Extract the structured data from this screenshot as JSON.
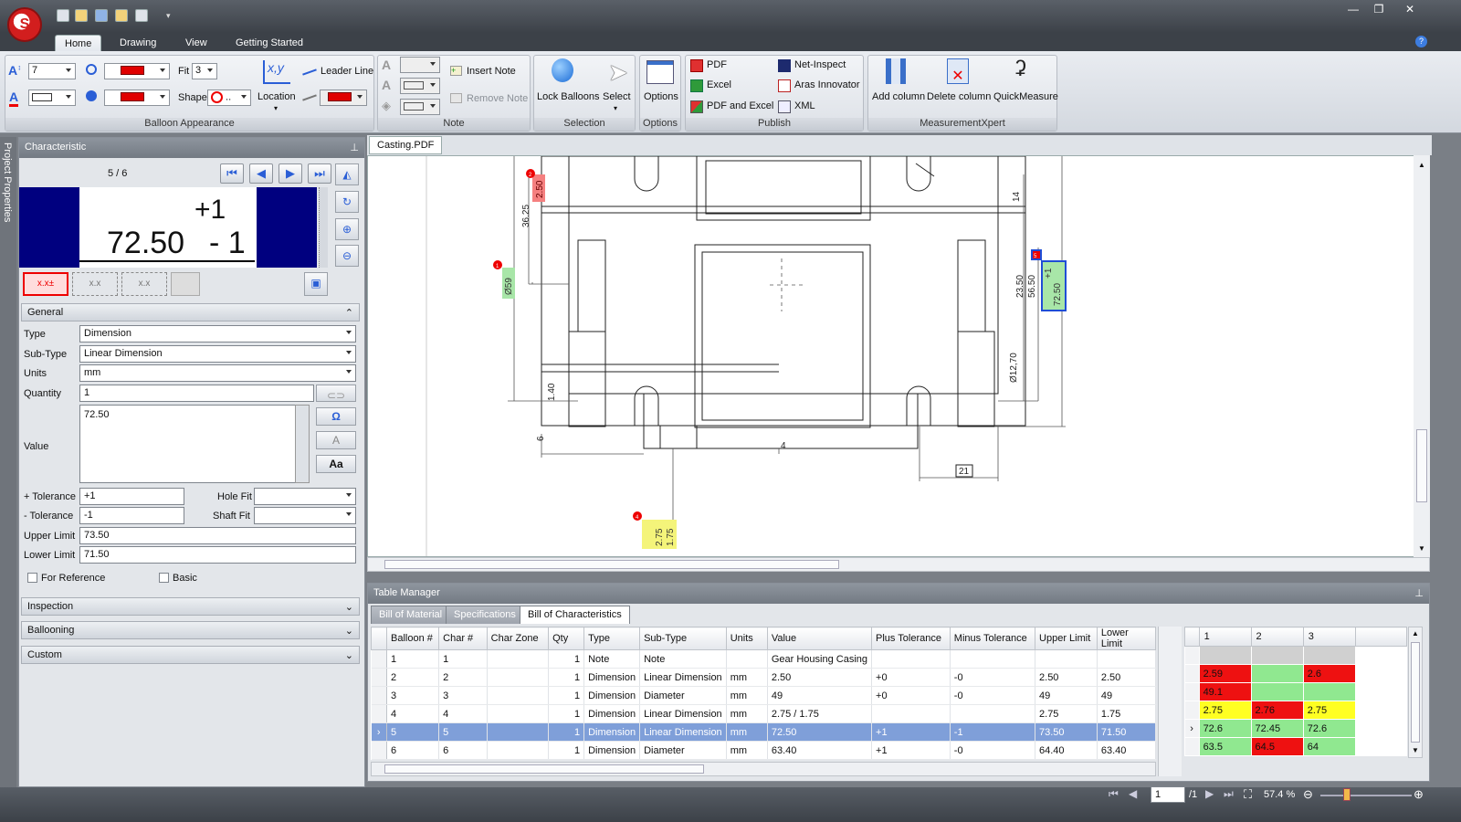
{
  "app": {
    "logo_text": "S"
  },
  "ribbon_tabs": [
    "Home",
    "Drawing",
    "View",
    "Getting Started"
  ],
  "ribbon": {
    "balloon_appearance": {
      "label": "Balloon Appearance",
      "font_size": "7",
      "fit_label": "Fit",
      "fit_value": "3",
      "shape_label": "Shape",
      "location_label": "Location",
      "leader_line_label": "Leader Line"
    },
    "note": {
      "label": "Note",
      "insert_note": "Insert Note",
      "remove_note": "Remove Note"
    },
    "selection": {
      "label": "Selection",
      "lock_balloons": "Lock Balloons",
      "select": "Select"
    },
    "options": {
      "label": "Options",
      "options_btn": "Options"
    },
    "publish": {
      "label": "Publish",
      "pdf": "PDF",
      "excel": "Excel",
      "pdf_excel": "PDF and Excel",
      "net_inspect": "Net-Inspect",
      "aras": "Aras Innovator",
      "xml": "XML"
    },
    "measurementxpert": {
      "label": "MeasurementXpert",
      "add_column": "Add column",
      "delete_column": "Delete column",
      "quick_measure": "QuickMeasure"
    }
  },
  "left_strip_label": "Project Properties",
  "characteristic": {
    "title": "Characteristic",
    "counter": "5 / 6",
    "preview_plus": "+1",
    "preview_value": "72.50",
    "preview_minus": "- 1",
    "sections": {
      "general": "General",
      "inspection": "Inspection",
      "ballooning": "Ballooning",
      "custom": "Custom"
    },
    "fields": {
      "type_label": "Type",
      "type_value": "Dimension",
      "subtype_label": "Sub-Type",
      "subtype_value": "Linear Dimension",
      "units_label": "Units",
      "units_value": "mm",
      "quantity_label": "Quantity",
      "quantity_value": "1",
      "value_label": "Value",
      "value_value": "72.50",
      "plus_tol_label": "+ Tolerance",
      "plus_tol_value": "+1",
      "minus_tol_label": "- Tolerance",
      "minus_tol_value": "-1",
      "hole_fit_label": "Hole Fit",
      "shaft_fit_label": "Shaft Fit",
      "upper_label": "Upper Limit",
      "upper_value": "73.50",
      "lower_label": "Lower Limit",
      "lower_value": "71.50",
      "for_reference": "For Reference",
      "basic": "Basic"
    }
  },
  "document": {
    "tab": "Casting.PDF"
  },
  "drawing_labels": {
    "dim_36_25": "36.25",
    "dim_2_50": "2.50",
    "dim_59": "Ø59",
    "dim_14": "14",
    "dim_23_50": "23.50",
    "dim_56_50": "56.50",
    "dim_12_70": "Ø12,70",
    "dim_1_40": "1.40",
    "dim_6": "6",
    "dim_4": "4",
    "dim_21": "21",
    "callout_top": "2.75",
    "callout_bottom": "1.75",
    "sel_plus": "+1",
    "sel_value": "72.50",
    "sel_minus": "-1",
    "b1": "1",
    "b2": "2",
    "b4": "4",
    "b5": "5"
  },
  "table_manager": {
    "title": "Table Manager",
    "tabs": [
      "Bill of Material",
      "Specifications",
      "Bill of Characteristics"
    ],
    "columns": [
      "Balloon #",
      "Char #",
      "Char Zone",
      "Qty",
      "Type",
      "Sub-Type",
      "Units",
      "Value",
      "Plus Tolerance",
      "Minus Tolerance",
      "Upper Limit",
      "Lower Limit"
    ],
    "rows": [
      [
        "1",
        "1",
        "",
        "1",
        "Note",
        "Note",
        "",
        "Gear Housing Casing",
        "",
        "",
        "",
        ""
      ],
      [
        "2",
        "2",
        "",
        "1",
        "Dimension",
        "Linear Dimension",
        "mm",
        "2.50",
        "+0",
        "-0",
        "2.50",
        "2.50"
      ],
      [
        "3",
        "3",
        "",
        "1",
        "Dimension",
        "Diameter",
        "mm",
        "49",
        "+0",
        "-0",
        "49",
        "49"
      ],
      [
        "4",
        "4",
        "",
        "1",
        "Dimension",
        "Linear Dimension",
        "mm",
        "2.75 / 1.75",
        "",
        "",
        "2.75",
        "1.75"
      ],
      [
        "5",
        "5",
        "",
        "1",
        "Dimension",
        "Linear Dimension",
        "mm",
        "72.50",
        "+1",
        "-1",
        "73.50",
        "71.50"
      ],
      [
        "6",
        "6",
        "",
        "1",
        "Dimension",
        "Diameter",
        "mm",
        "63.40",
        "+1",
        "-0",
        "64.40",
        "63.40"
      ]
    ],
    "inspection_columns": [
      "1",
      "2",
      "3"
    ],
    "inspection_rows": [
      [
        {
          "v": "",
          "c": "#d0d0d0"
        },
        {
          "v": "",
          "c": "#d0d0d0"
        },
        {
          "v": "",
          "c": "#d0d0d0"
        }
      ],
      [
        {
          "v": "2.59",
          "c": "#ee1111"
        },
        {
          "v": "",
          "c": "#90e890"
        },
        {
          "v": "2.6",
          "c": "#ee1111"
        }
      ],
      [
        {
          "v": "49.1",
          "c": "#ee1111"
        },
        {
          "v": "",
          "c": "#90e890"
        },
        {
          "v": "",
          "c": "#90e890"
        }
      ],
      [
        {
          "v": "2.75",
          "c": "#ffff22"
        },
        {
          "v": "2.76",
          "c": "#ee1111"
        },
        {
          "v": "2.75",
          "c": "#ffff22"
        }
      ],
      [
        {
          "v": "72.6",
          "c": "#90e890"
        },
        {
          "v": "72.45",
          "c": "#90e890"
        },
        {
          "v": "72.6",
          "c": "#90e890"
        }
      ],
      [
        {
          "v": "63.5",
          "c": "#90e890"
        },
        {
          "v": "64.5",
          "c": "#ee1111"
        },
        {
          "v": "64",
          "c": "#90e890"
        }
      ]
    ]
  },
  "status": {
    "page": "1",
    "page_total": "/1",
    "zoom": "57.4 %"
  }
}
